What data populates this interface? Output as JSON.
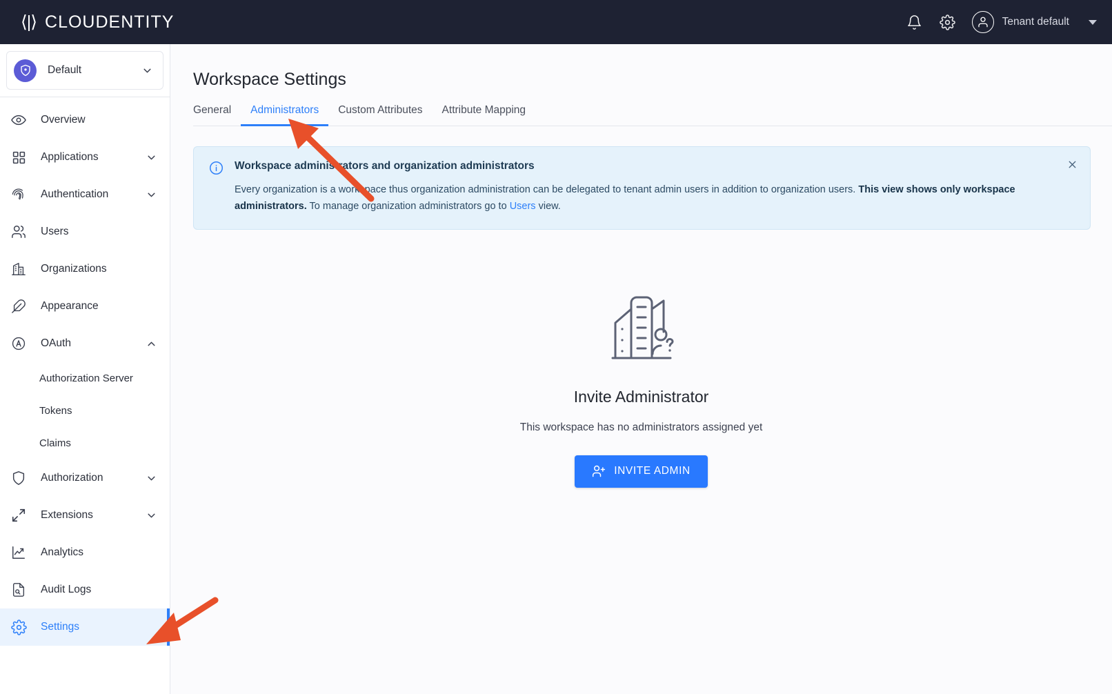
{
  "topbar": {
    "logo_mark": "⟨|⟩",
    "logo_text": "CLOUDENTITY",
    "notifications_icon": "bell-icon",
    "settings_icon": "gear-icon",
    "tenant_label": "Tenant default"
  },
  "sidebar": {
    "workspace": {
      "name": "Default",
      "icon": "shield-check-icon"
    },
    "items": [
      {
        "label": "Overview",
        "icon": "eye-icon",
        "expandable": false,
        "active": false
      },
      {
        "label": "Applications",
        "icon": "grid-icon",
        "expandable": true,
        "expanded": false,
        "active": false
      },
      {
        "label": "Authentication",
        "icon": "fingerprint-icon",
        "expandable": true,
        "expanded": false,
        "active": false
      },
      {
        "label": "Users",
        "icon": "users-icon",
        "expandable": false,
        "active": false
      },
      {
        "label": "Organizations",
        "icon": "building-icon",
        "expandable": false,
        "active": false
      },
      {
        "label": "Appearance",
        "icon": "feather-icon",
        "expandable": false,
        "active": false
      },
      {
        "label": "OAuth",
        "icon": "oauth-circle-a-icon",
        "expandable": true,
        "expanded": true,
        "active": false
      },
      {
        "label": "Authorization",
        "icon": "shield-icon",
        "expandable": true,
        "expanded": false,
        "active": false
      },
      {
        "label": "Extensions",
        "icon": "expand-icon",
        "expandable": true,
        "expanded": false,
        "active": false
      },
      {
        "label": "Analytics",
        "icon": "chart-line-icon",
        "expandable": false,
        "active": false
      },
      {
        "label": "Audit Logs",
        "icon": "document-search-icon",
        "expandable": false,
        "active": false
      },
      {
        "label": "Settings",
        "icon": "gear-icon",
        "expandable": false,
        "active": true
      }
    ],
    "oauth_subitems": [
      {
        "label": "Authorization Server"
      },
      {
        "label": "Tokens"
      },
      {
        "label": "Claims"
      }
    ]
  },
  "main": {
    "page_title": "Workspace Settings",
    "tabs": [
      {
        "label": "General",
        "active": false
      },
      {
        "label": "Administrators",
        "active": true
      },
      {
        "label": "Custom Attributes",
        "active": false
      },
      {
        "label": "Attribute Mapping",
        "active": false
      }
    ],
    "banner": {
      "icon": "info-icon",
      "title": "Workspace administrators and organization administrators",
      "body_part1": "Every organization is a workspace thus organization administration can be delegated to tenant admin users in addition to organization users. ",
      "body_bold": "This view shows only workspace administrators.",
      "body_part2": " To manage organization administrators go to ",
      "body_link": "Users",
      "body_part3": " view.",
      "close_icon": "close-icon"
    },
    "empty_state": {
      "illustration": "buildings-with-person-question-icon",
      "title": "Invite Administrator",
      "subtitle": "This workspace has no administrators assigned yet",
      "button_label": "INVITE ADMIN",
      "button_icon": "person-add-icon"
    }
  },
  "annotations": {
    "arrow_color": "#e8502a",
    "arrow_to_tab": "Administrators",
    "arrow_to_sidebar_item": "Settings"
  },
  "colors": {
    "topbar_bg": "#1e2233",
    "accent_blue": "#2d7ff9",
    "button_blue": "#2979ff",
    "banner_bg": "#e5f2fb",
    "workspace_badge": "#5b5bd6",
    "annotation_red": "#e8502a"
  }
}
